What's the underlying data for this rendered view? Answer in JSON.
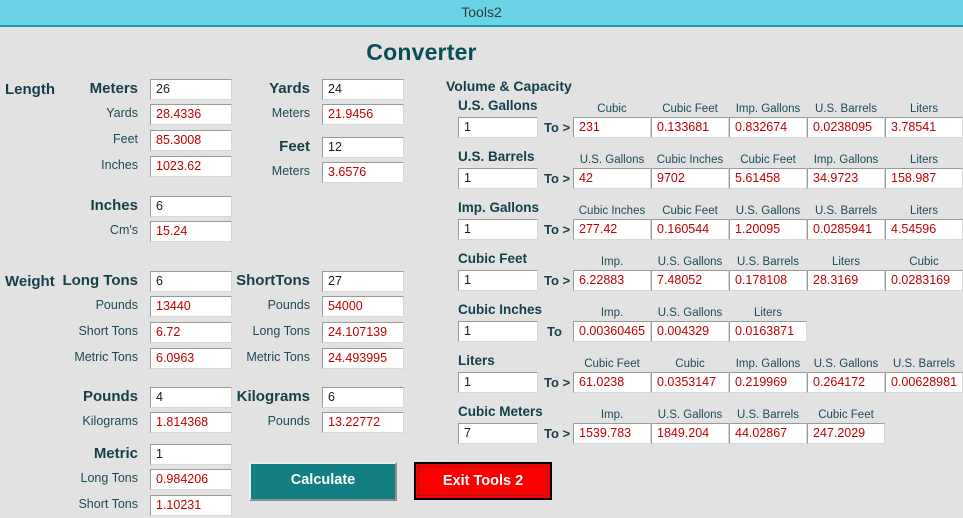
{
  "window": {
    "title": "Tools2"
  },
  "page": {
    "heading": "Converter"
  },
  "length": {
    "group_label": "Length",
    "blocks": [
      {
        "unit": "Meters",
        "value": "26",
        "rows": [
          {
            "label": "Yards",
            "value": "28.4336"
          },
          {
            "label": "Feet",
            "value": "85.3008"
          },
          {
            "label": "Inches",
            "value": "1023.62"
          }
        ]
      },
      {
        "unit": "Inches",
        "value": "6",
        "rows": [
          {
            "label": "Cm's",
            "value": "15.24"
          }
        ]
      },
      {
        "unit": "Yards",
        "value": "24",
        "rows": [
          {
            "label": "Meters",
            "value": "21.9456"
          }
        ]
      },
      {
        "unit": "Feet",
        "value": "12",
        "rows": [
          {
            "label": "Meters",
            "value": "3.6576"
          }
        ]
      }
    ]
  },
  "weight": {
    "group_label": "Weight",
    "blocks": [
      {
        "unit": "Long Tons",
        "value": "6",
        "rows": [
          {
            "label": "Pounds",
            "value": "13440"
          },
          {
            "label": "Short Tons",
            "value": "6.72"
          },
          {
            "label": "Metric Tons",
            "value": "6.0963"
          }
        ]
      },
      {
        "unit": "Pounds",
        "value": "4",
        "rows": [
          {
            "label": "Kilograms",
            "value": "1.814368"
          }
        ]
      },
      {
        "unit": "Metric",
        "value": "1",
        "rows": [
          {
            "label": "Long Tons",
            "value": "0.984206"
          },
          {
            "label": "Short Tons",
            "value": "1.10231"
          }
        ]
      },
      {
        "unit": "ShortTons",
        "value": "27",
        "rows": [
          {
            "label": "Pounds",
            "value": "54000"
          },
          {
            "label": "Long Tons",
            "value": "24.107139"
          },
          {
            "label": "Metric Tons",
            "value": "24.493995"
          }
        ]
      },
      {
        "unit": "Kilograms",
        "value": "6",
        "rows": [
          {
            "label": "Pounds",
            "value": "13.22772"
          }
        ]
      }
    ]
  },
  "volume": {
    "section_title": "Volume & Capacity",
    "rows": [
      {
        "unit": "U.S. Gallons",
        "value": "1",
        "to": "To >",
        "columns": [
          {
            "header": "Cubic",
            "value": "231"
          },
          {
            "header": "Cubic Feet",
            "value": "0.133681"
          },
          {
            "header": "Imp. Gallons",
            "value": "0.832674"
          },
          {
            "header": "U.S. Barrels",
            "value": "0.0238095"
          },
          {
            "header": "Liters",
            "value": "3.78541"
          }
        ]
      },
      {
        "unit": "U.S. Barrels",
        "value": "1",
        "to": "To >",
        "columns": [
          {
            "header": "U.S. Gallons",
            "value": "42"
          },
          {
            "header": "Cubic Inches",
            "value": "9702"
          },
          {
            "header": "Cubic Feet",
            "value": "5.61458"
          },
          {
            "header": "Imp. Gallons",
            "value": "34.9723"
          },
          {
            "header": "Liters",
            "value": "158.987"
          }
        ]
      },
      {
        "unit": "Imp. Gallons",
        "value": "1",
        "to": "To >",
        "columns": [
          {
            "header": "Cubic Inches",
            "value": "277.42"
          },
          {
            "header": "Cubic Feet",
            "value": "0.160544"
          },
          {
            "header": "U.S. Gallons",
            "value": "1.20095"
          },
          {
            "header": "U.S. Barrels",
            "value": "0.0285941"
          },
          {
            "header": "Liters",
            "value": "4.54596"
          }
        ]
      },
      {
        "unit": "Cubic Feet",
        "value": "1",
        "to": "To >",
        "columns": [
          {
            "header": "Imp.",
            "value": "6.22883"
          },
          {
            "header": "U.S. Gallons",
            "value": "7.48052"
          },
          {
            "header": "U.S. Barrels",
            "value": "0.178108"
          },
          {
            "header": "Liters",
            "value": "28.3169"
          },
          {
            "header": "Cubic",
            "value": "0.0283169"
          }
        ]
      },
      {
        "unit": "Cubic Inches",
        "value": "1",
        "to": "To",
        "columns": [
          {
            "header": "Imp.",
            "value": "0.00360465"
          },
          {
            "header": "U.S. Gallons",
            "value": "0.004329"
          },
          {
            "header": "Liters",
            "value": "0.0163871"
          }
        ]
      },
      {
        "unit": "Liters",
        "value": "1",
        "to": "To >",
        "columns": [
          {
            "header": "Cubic Feet",
            "value": "61.0238"
          },
          {
            "header": "Cubic",
            "value": "0.0353147"
          },
          {
            "header": "Imp. Gallons",
            "value": "0.219969"
          },
          {
            "header": "U.S. Gallons",
            "value": "0.264172"
          },
          {
            "header": "U.S. Barrels",
            "value": "0.00628981"
          }
        ]
      },
      {
        "unit": "Cubic Meters",
        "value": "7",
        "to": "To >",
        "columns": [
          {
            "header": "Imp.",
            "value": "1539.783"
          },
          {
            "header": "U.S. Gallons",
            "value": "1849.204"
          },
          {
            "header": "U.S. Barrels",
            "value": "44.02867"
          },
          {
            "header": "Cubic Feet",
            "value": "247.2029"
          }
        ]
      }
    ]
  },
  "buttons": {
    "calculate": "Calculate",
    "exit": "Exit Tools 2"
  },
  "colors": {
    "titlebar": "#69d4e6",
    "heading": "#0b4d55",
    "result_text": "#c00000",
    "calculate_bg": "#117f84",
    "exit_bg": "#fb0000"
  }
}
